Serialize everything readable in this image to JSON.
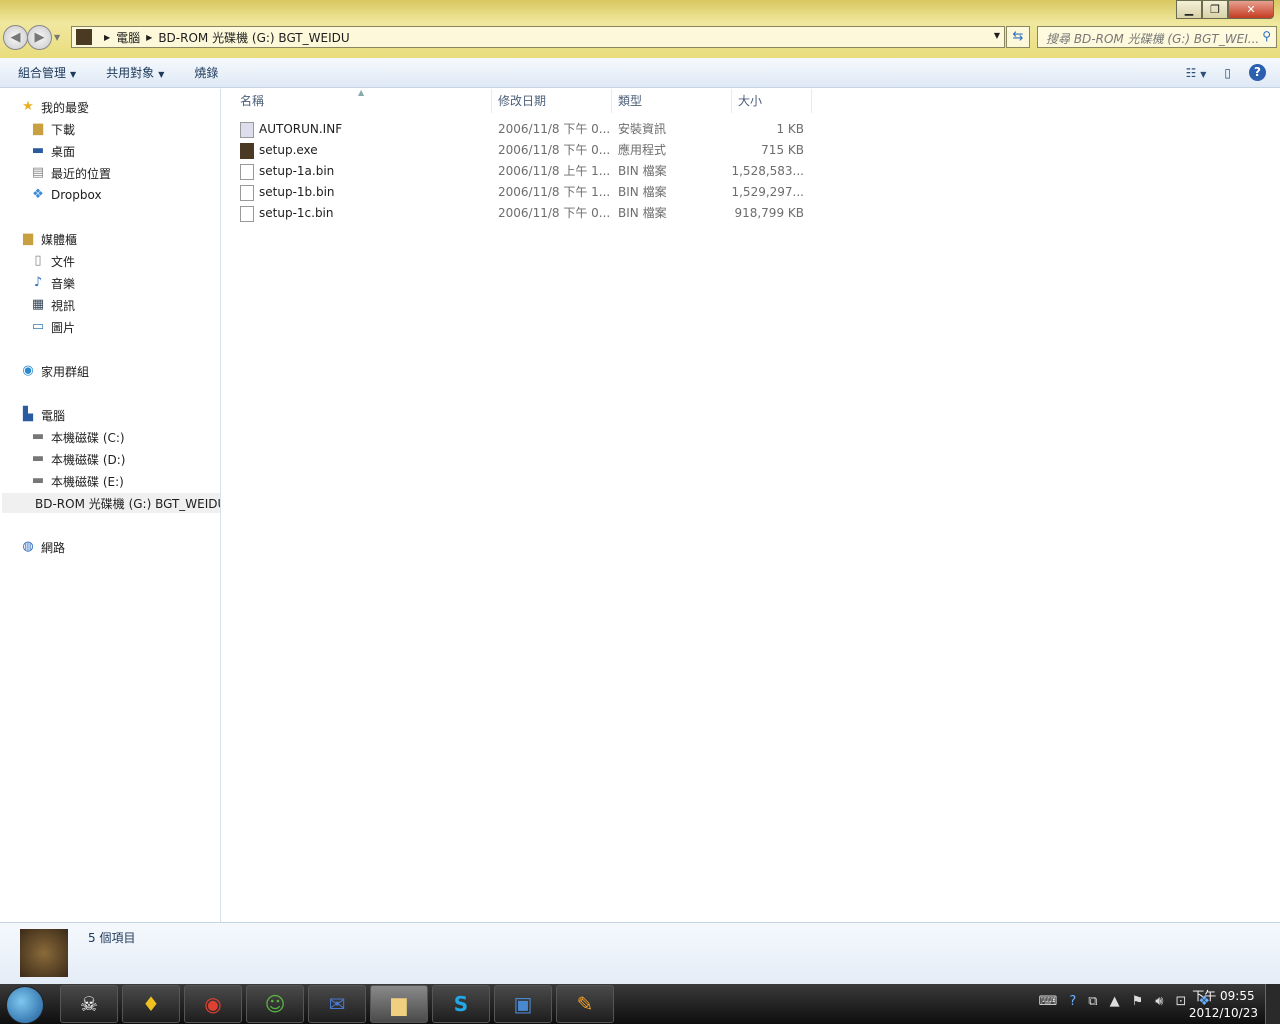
{
  "address": {
    "crumbs": [
      "電腦",
      "BD-ROM 光碟機 (G:) BGT_WEIDU"
    ],
    "search_placeholder": "搜尋 BD-ROM 光碟機 (G:) BGT_WEI..."
  },
  "toolbar": {
    "organize": "組合管理",
    "share": "共用對象",
    "burn": "燒錄"
  },
  "sidebar": {
    "favorites": {
      "label": "我的最愛",
      "items": [
        "下載",
        "桌面",
        "最近的位置",
        "Dropbox"
      ]
    },
    "libraries": {
      "label": "媒體櫃",
      "items": [
        "文件",
        "音樂",
        "視訊",
        "圖片"
      ]
    },
    "homegroup": "家用群組",
    "computer": {
      "label": "電腦",
      "items": [
        "本機磁碟 (C:)",
        "本機磁碟 (D:)",
        "本機磁碟 (E:)",
        "BD-ROM 光碟機 (G:) BGT_WEIDU"
      ]
    },
    "network": "網路"
  },
  "columns": {
    "name": "名稱",
    "date": "修改日期",
    "type": "類型",
    "size": "大小"
  },
  "files": [
    {
      "name": "AUTORUN.INF",
      "date": "2006/11/8 下午 0...",
      "type": "安裝資訊",
      "size": "1 KB"
    },
    {
      "name": "setup.exe",
      "date": "2006/11/8 下午 0...",
      "type": "應用程式",
      "size": "715 KB"
    },
    {
      "name": "setup-1a.bin",
      "date": "2006/11/8 上午 1...",
      "type": "BIN 檔案",
      "size": "1,528,583..."
    },
    {
      "name": "setup-1b.bin",
      "date": "2006/11/8 下午 1...",
      "type": "BIN 檔案",
      "size": "1,529,297..."
    },
    {
      "name": "setup-1c.bin",
      "date": "2006/11/8 下午 0...",
      "type": "BIN 檔案",
      "size": "918,799 KB"
    }
  ],
  "status": {
    "count": "5 個項目"
  },
  "clock": {
    "time": "下午 09:55",
    "date": "2012/10/23"
  }
}
